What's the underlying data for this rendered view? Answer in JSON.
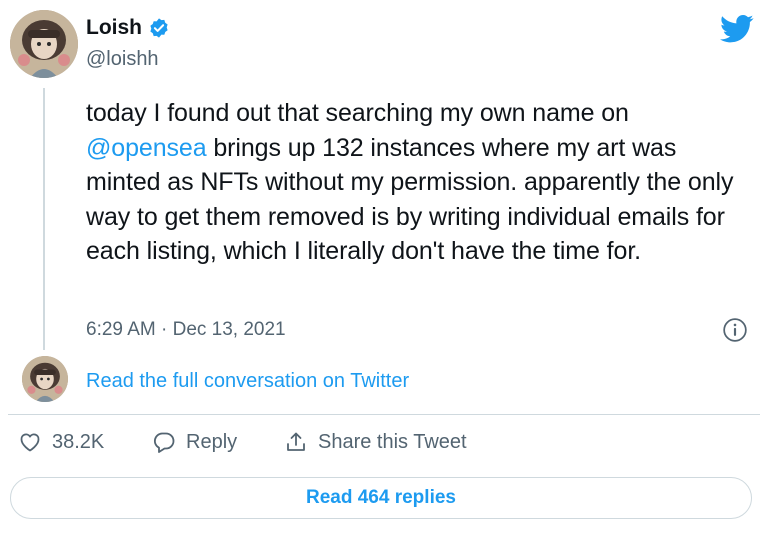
{
  "author": {
    "display_name": "Loish",
    "handle": "@loishh"
  },
  "tweet": {
    "text_before_mention": "today I found out that searching my own name on ",
    "mention": "@opensea",
    "text_after_mention": " brings up 132 instances where my art was minted as NFTs without my permission. apparently the only way to get them removed is by writing individual emails for each listing, which I literally don't have the time for.",
    "timestamp": "6:29 AM · Dec 13, 2021"
  },
  "conversation": {
    "link_text": "Read the full conversation on Twitter"
  },
  "actions": {
    "like_count": "38.2K",
    "reply_label": "Reply",
    "share_label": "Share this Tweet"
  },
  "footer": {
    "read_replies_label": "Read 464 replies"
  },
  "colors": {
    "accent": "#1d9bf0",
    "muted": "#536471",
    "border": "#cfd9de"
  },
  "icons": {
    "verified": "verified-badge-icon",
    "logo": "twitter-bird-icon",
    "info": "info-icon",
    "like": "heart-icon",
    "reply": "reply-bubble-icon",
    "share": "share-upload-icon"
  }
}
